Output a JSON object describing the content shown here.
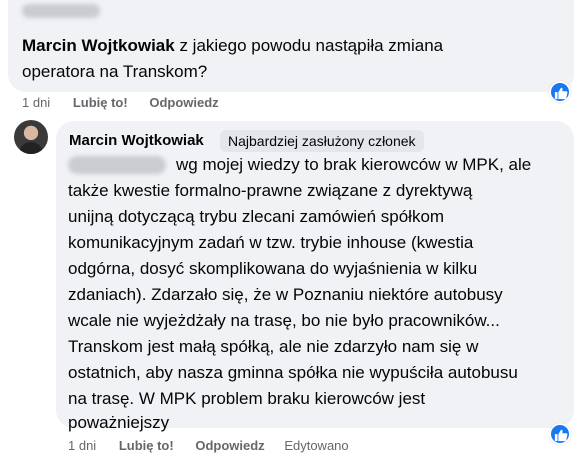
{
  "comment1": {
    "author": "Marcin Wojtkowiak",
    "text_line1": " z jakiego powodu nastąpiła zmiana",
    "text_line2": "operatora na Transkom?",
    "time": "1 dni",
    "like_label": "Lubię to!",
    "reply_label": "Odpowiedz",
    "reaction_icon": "like-icon"
  },
  "comment2": {
    "author": "Marcin Wojtkowiak",
    "badge": "Najbardziej zasłużony członek",
    "lines": [
      "wg mojej wiedzy to brak kierowców w MPK, ale",
      "także kwestie formalno-prawne związane z dyrektywą",
      "unijną dotyczącą trybu zlecani zamówień spółkom",
      "komunikacyjnym zadań w tzw. trybie inhouse (kwestia",
      "odgórna, dosyć skomplikowana do wyjaśnienia w kilku",
      "zdaniach). Zdarzało się, że w Poznaniu niektóre autobusy",
      "wcale nie wyjeżdżały na trasę, bo nie było pracowników...",
      "Transkom jest małą spółką, ale nie zdarzyło nam się w",
      "ostatnich, aby nasza gminna spółka nie wypuściła autobusu",
      "na trasę. W MPK problem braku kierowców jest",
      "poważniejszy"
    ],
    "time": "1 dni",
    "like_label": "Lubię to!",
    "reply_label": "Odpowiedz",
    "edited_label": "Edytowano",
    "reaction_icon": "like-icon"
  },
  "colors": {
    "bubble": "#f0f2f5",
    "secondary_text": "#65676b",
    "like_blue": "#1877f2"
  }
}
